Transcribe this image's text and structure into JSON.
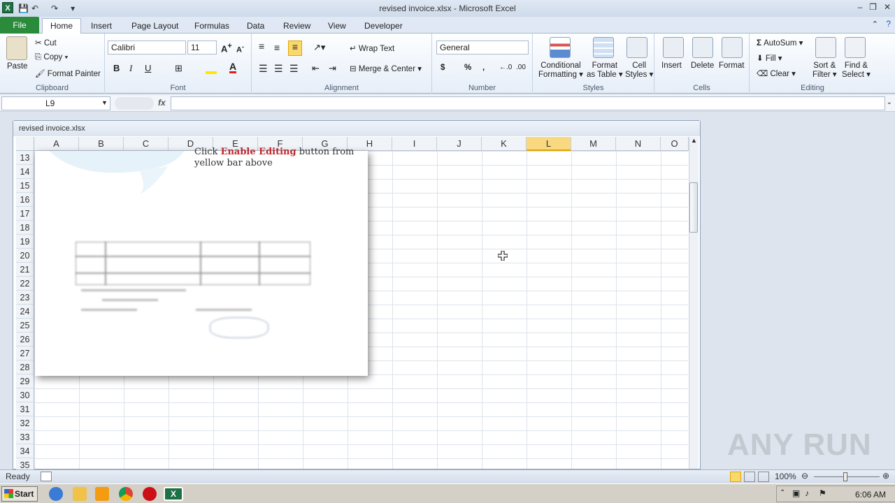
{
  "window": {
    "title": "revised invoice.xlsx - Microsoft Excel"
  },
  "tabs": [
    "File",
    "Home",
    "Insert",
    "Page Layout",
    "Formulas",
    "Data",
    "Review",
    "View",
    "Developer"
  ],
  "clipboard": {
    "paste": "Paste",
    "cut": "Cut",
    "copy": "Copy",
    "format_painter": "Format Painter",
    "label": "Clipboard"
  },
  "font": {
    "name": "Calibri",
    "size": "11",
    "label": "Font"
  },
  "alignment": {
    "wrap": "Wrap Text",
    "merge": "Merge & Center",
    "label": "Alignment"
  },
  "number": {
    "format": "General",
    "label": "Number",
    "currency": "$",
    "percent": "%",
    "comma": ","
  },
  "styles": {
    "conditional1": "Conditional",
    "conditional2": "Formatting",
    "table1": "Format",
    "table2": "as Table",
    "cell1": "Cell",
    "cell2": "Styles",
    "label": "Styles"
  },
  "cells": {
    "insert": "Insert",
    "delete": "Delete",
    "format": "Format",
    "label": "Cells"
  },
  "editing": {
    "autosum": "AutoSum",
    "fill": "Fill",
    "clear": "Clear",
    "sort1": "Sort &",
    "sort2": "Filter",
    "find1": "Find &",
    "find2": "Select",
    "label": "Editing",
    "sigma": "Σ"
  },
  "formula": {
    "namebox": "L9",
    "fx": "fx",
    "value": ""
  },
  "workbook": {
    "title": "revised invoice.xlsx"
  },
  "columns": [
    "A",
    "B",
    "C",
    "D",
    "E",
    "F",
    "G",
    "H",
    "I",
    "J",
    "K",
    "L",
    "M",
    "N",
    "O"
  ],
  "rows": [
    "13",
    "14",
    "15",
    "16",
    "17",
    "18",
    "19",
    "20",
    "21",
    "22",
    "23",
    "24",
    "25",
    "26",
    "27",
    "28",
    "29",
    "30",
    "31",
    "32",
    "33",
    "34",
    "35"
  ],
  "selected_column": "L",
  "picture": {
    "line1a": "Click ",
    "line1b": "Enable Editing",
    "line1c": " button from",
    "line2": "yellow bar above"
  },
  "status": {
    "ready": "Ready",
    "zoom": "100%"
  },
  "taskbar": {
    "start": "Start",
    "time": "6:06 AM"
  },
  "watermark": "ANY RUN"
}
